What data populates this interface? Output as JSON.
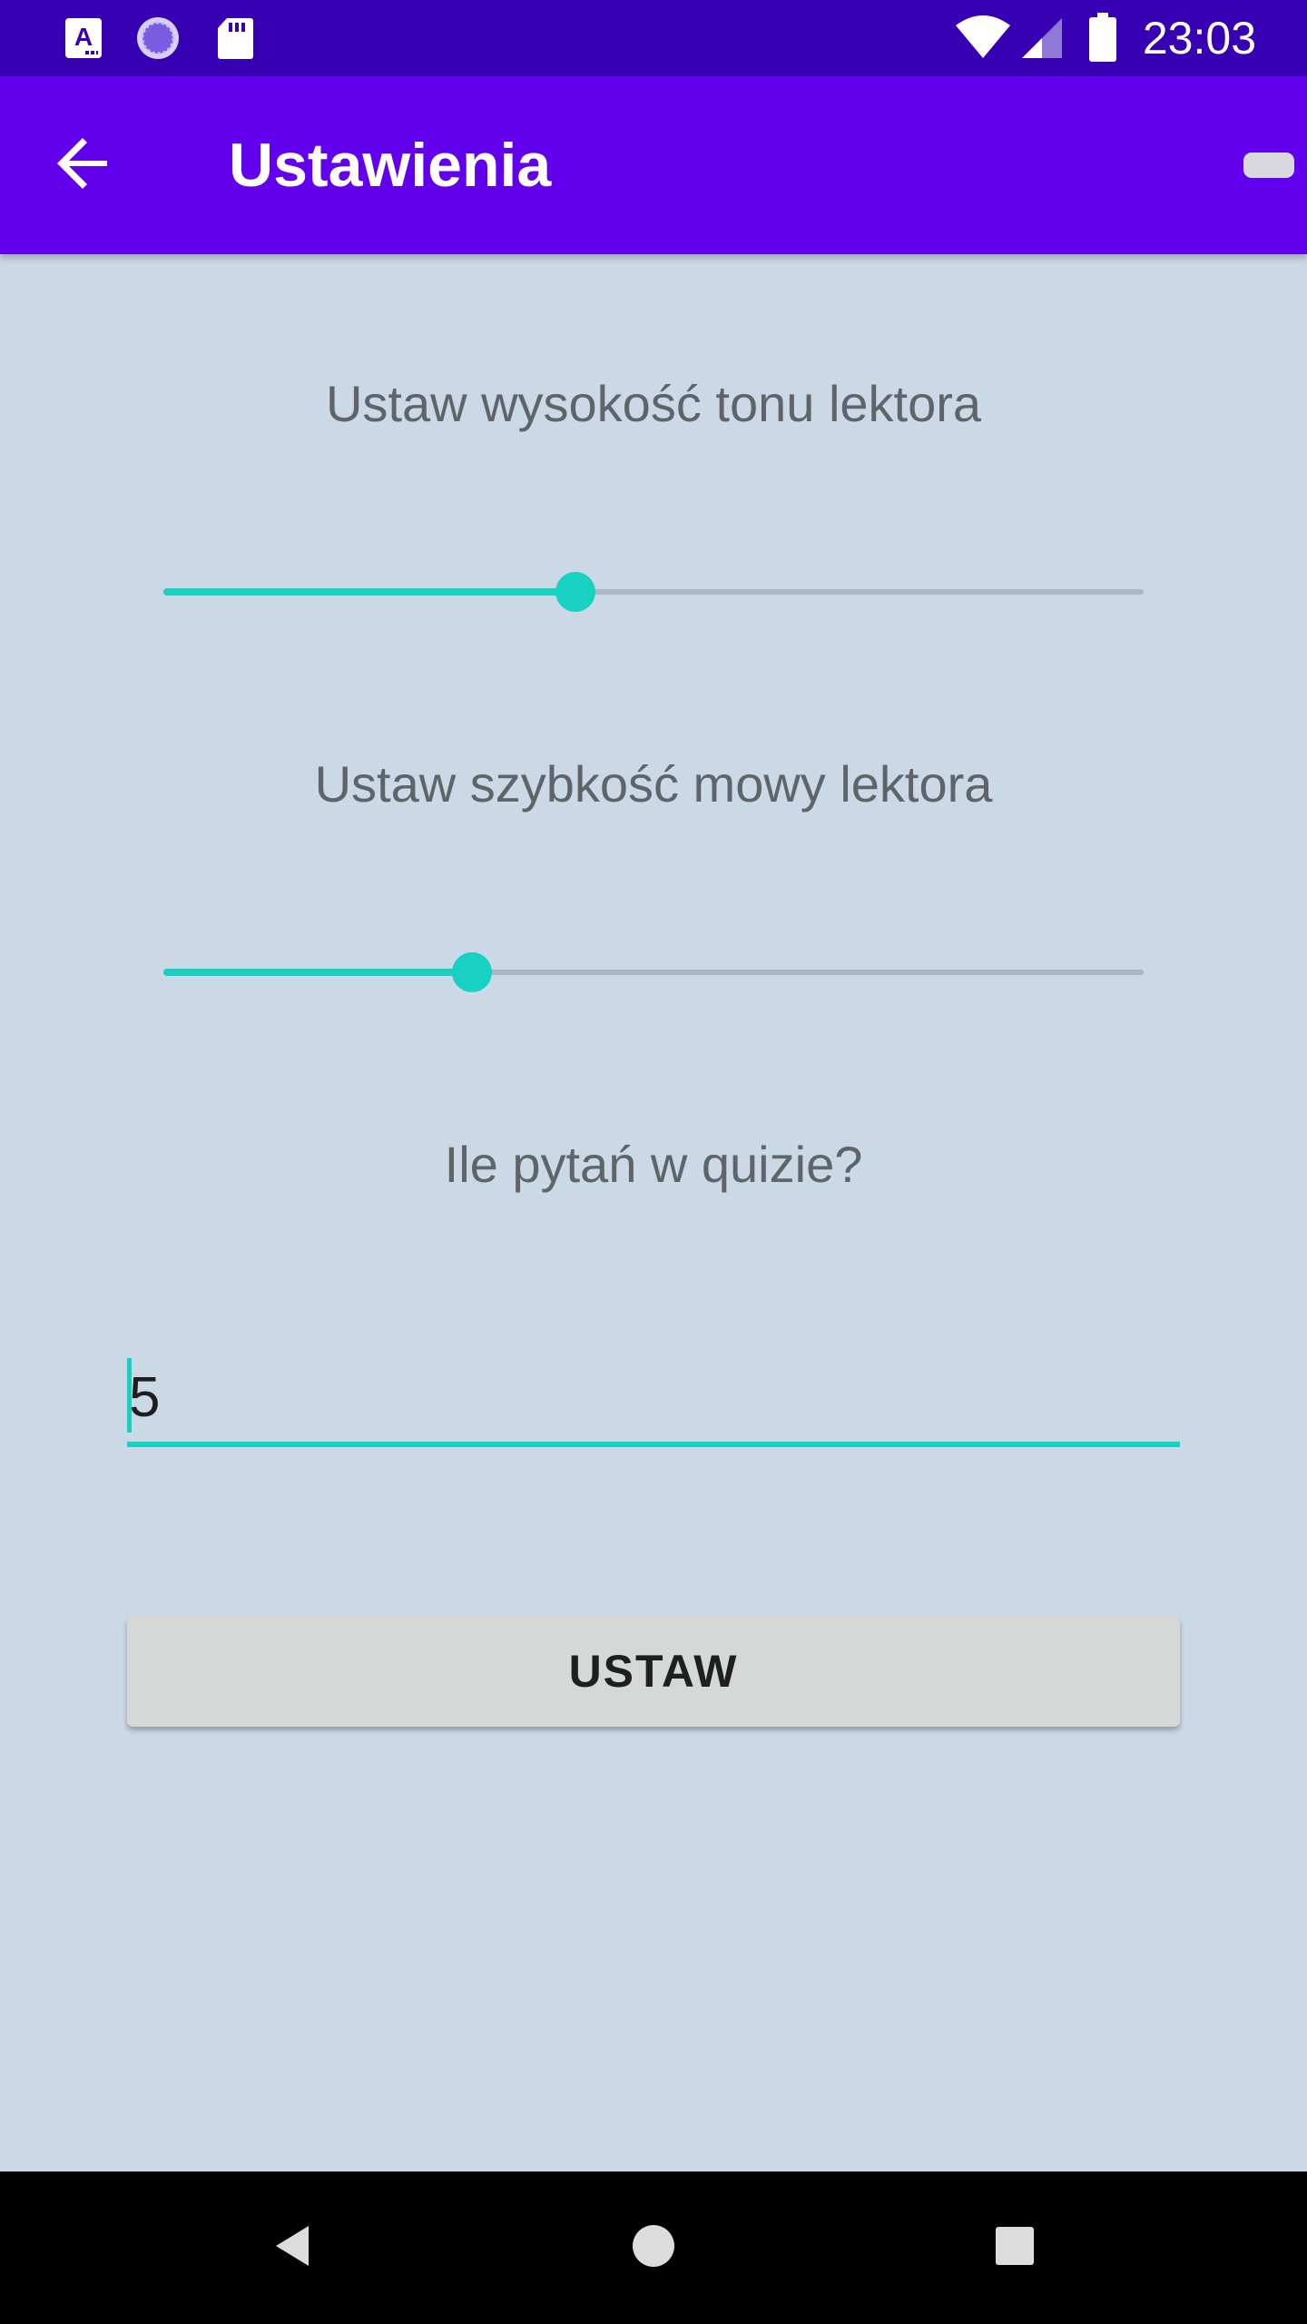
{
  "status_bar": {
    "time": "23:03",
    "icons": [
      "font-app-icon",
      "loading-circle-icon",
      "sd-card-icon",
      "wifi-icon",
      "signal-icon",
      "battery-icon"
    ]
  },
  "app_bar": {
    "title": "Ustawienia",
    "back_icon": "arrow-back-icon",
    "background": "#6200ee",
    "status_background": "#3700b3"
  },
  "settings": {
    "pitch": {
      "label": "Ustaw wysokość tonu lektora",
      "value_fraction": 0.42
    },
    "speed": {
      "label": "Ustaw szybkość mowy lektora",
      "value_fraction": 0.315
    },
    "quiz": {
      "label": "Ile pytań w quizie?",
      "value": "5"
    },
    "submit_label": "USTAW"
  },
  "colors": {
    "accent": "#19d1c2",
    "background": "#cbd9e6",
    "text_secondary": "#5f6468",
    "button": "#d6d7d7"
  },
  "nav_bar": {
    "buttons": [
      "back-triangle-icon",
      "home-circle-icon",
      "recents-square-icon"
    ]
  }
}
